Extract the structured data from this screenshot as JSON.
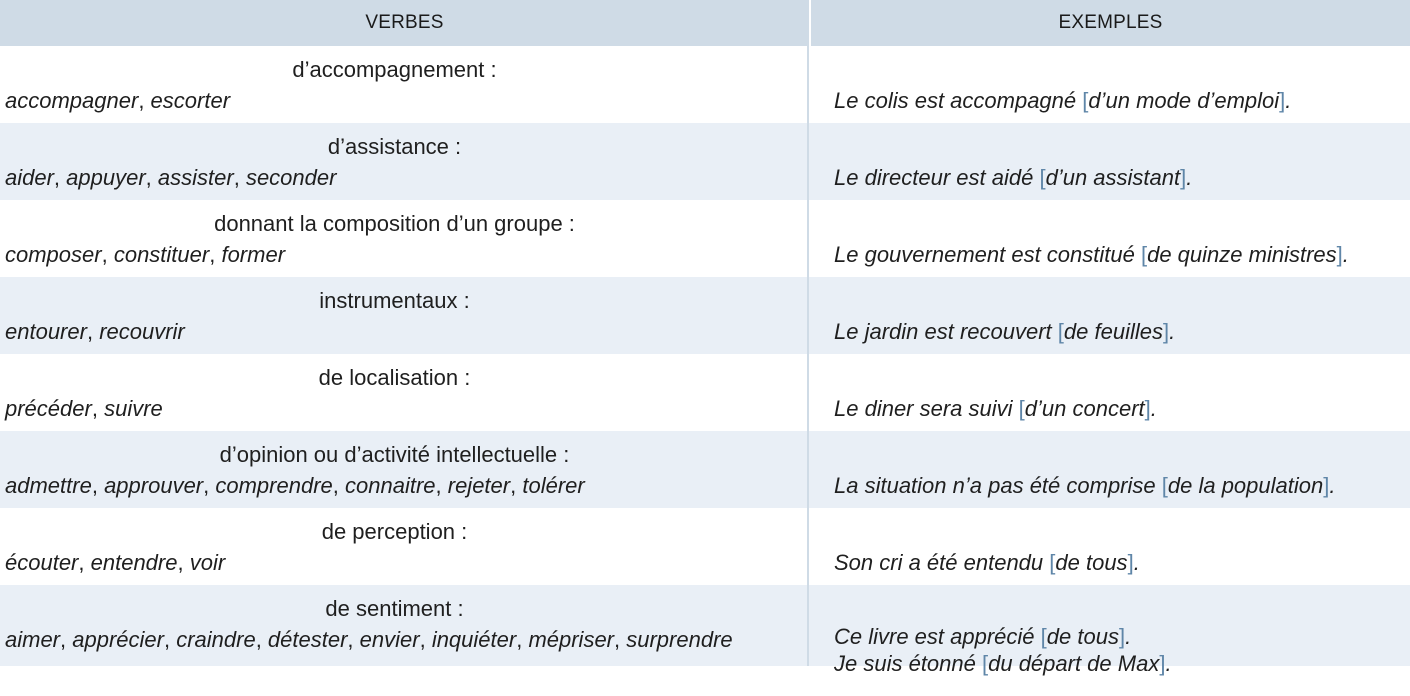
{
  "header": {
    "col1": "VERBES",
    "col2": "EXEMPLES"
  },
  "rows": [
    {
      "category": "d’accompagnement :",
      "verbs": [
        "accompagner",
        "escorter"
      ],
      "examples": [
        {
          "before": "Le colis est accompagné ",
          "inside": "d’un mode d’emploi",
          "after": "."
        }
      ]
    },
    {
      "category": "d’assistance :",
      "verbs": [
        "aider",
        "appuyer",
        "assister",
        "seconder"
      ],
      "examples": [
        {
          "before": "Le directeur est aidé ",
          "inside": "d’un assistant",
          "after": "."
        }
      ]
    },
    {
      "category": "donnant la composition d’un groupe :",
      "verbs": [
        "composer",
        "constituer",
        "former"
      ],
      "examples": [
        {
          "before": "Le gouvernement est constitué ",
          "inside": "de quinze ministres",
          "after": "."
        }
      ]
    },
    {
      "category": "instrumentaux :",
      "verbs": [
        "entourer",
        "recouvrir"
      ],
      "examples": [
        {
          "before": "Le jardin est recouvert ",
          "inside": "de feuilles",
          "after": "."
        }
      ]
    },
    {
      "category": "de localisation :",
      "verbs": [
        "précéder",
        "suivre"
      ],
      "examples": [
        {
          "before": "Le diner sera suivi ",
          "inside": "d’un concert",
          "after": "."
        }
      ]
    },
    {
      "category": "d’opinion ou d’activité intellectuelle :",
      "verbs": [
        "admettre",
        "approuver",
        "comprendre",
        "connaitre",
        "rejeter",
        "tolérer"
      ],
      "examples": [
        {
          "before": "La situation n’a pas été comprise ",
          "inside": "de la population",
          "after": "."
        }
      ]
    },
    {
      "category": "de perception :",
      "verbs": [
        "écouter",
        "entendre",
        "voir"
      ],
      "examples": [
        {
          "before": "Son cri a été entendu ",
          "inside": "de tous",
          "after": "."
        }
      ]
    },
    {
      "category": "de sentiment :",
      "verbs": [
        "aimer",
        "apprécier",
        "craindre",
        "détester",
        "envier",
        "inquiéter",
        "mépriser",
        "surprendre"
      ],
      "examples": [
        {
          "before": "Ce livre est apprécié ",
          "inside": "de tous",
          "after": "."
        },
        {
          "before": "Je suis étonné ",
          "inside": "du départ de Max",
          "after": "."
        }
      ]
    }
  ],
  "colors": {
    "header_bg": "#cfdbe6",
    "alt_row_bg": "#e9eff6",
    "bracket": "#5f86a8"
  }
}
